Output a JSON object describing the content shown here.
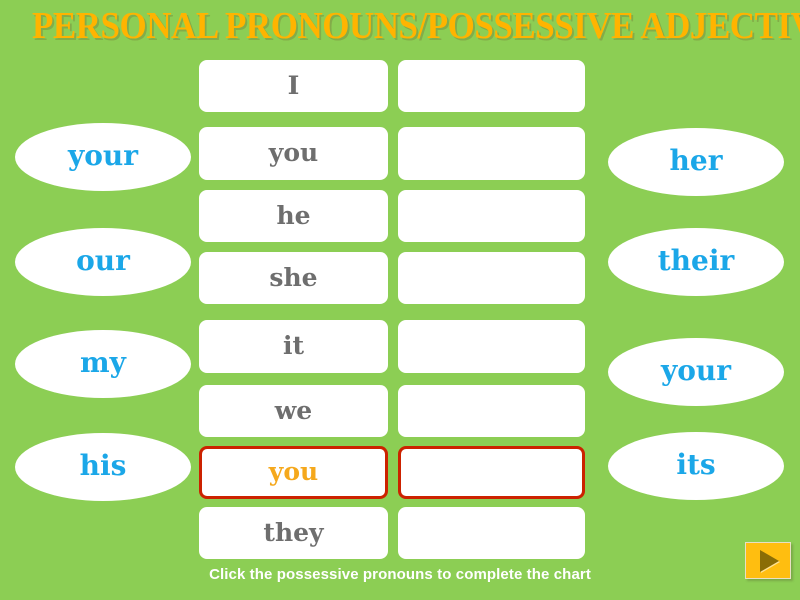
{
  "title": "PERSONAL PRONOUNS/POSSESSIVE ADJECTIVES",
  "colors": {
    "background_green": "#8CCE54",
    "title_orange": "#FFB400",
    "word_blue": "#1BA7E8",
    "pronoun_gray": "#6E6E6E",
    "selected_border_red": "#CC2200",
    "selected_text_orange": "#F5A81C",
    "button_gold": "#FFBE10",
    "button_arrow": "#8A6D06",
    "cell_white": "#FFFFFF"
  },
  "left_options": [
    {
      "label": "your"
    },
    {
      "label": "our"
    },
    {
      "label": "my"
    },
    {
      "label": "his"
    }
  ],
  "right_options": [
    {
      "label": "her"
    },
    {
      "label": "their"
    },
    {
      "label": "your"
    },
    {
      "label": "its"
    }
  ],
  "chart_rows": [
    {
      "pronoun": "I",
      "possessive": "",
      "selected": false
    },
    {
      "pronoun": "you",
      "possessive": "",
      "selected": false
    },
    {
      "pronoun": "he",
      "possessive": "",
      "selected": false
    },
    {
      "pronoun": "she",
      "possessive": "",
      "selected": false
    },
    {
      "pronoun": "it",
      "possessive": "",
      "selected": false
    },
    {
      "pronoun": "we",
      "possessive": "",
      "selected": false
    },
    {
      "pronoun": "you",
      "possessive": "",
      "selected": true
    },
    {
      "pronoun": "they",
      "possessive": "",
      "selected": false
    }
  ],
  "footer": {
    "instruction": "Click the possessive pronouns to complete the chart"
  },
  "next_button": {
    "icon": "play-triangle-icon",
    "label": ""
  }
}
